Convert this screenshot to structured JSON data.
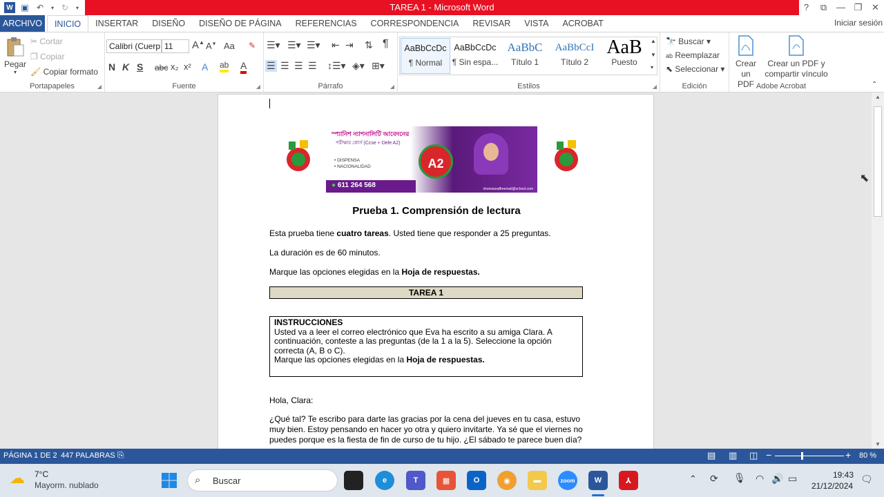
{
  "window": {
    "title": "TAREA 1 -  Microsoft Word",
    "help": "?",
    "restore_ribbon": "⧉",
    "minimize": "—",
    "maximize": "❐",
    "close": "✕"
  },
  "qat": {
    "word_icon": "W",
    "save": "💾",
    "undo": "↶",
    "redo": "↻",
    "customize": "▾"
  },
  "menu": {
    "file": "ARCHIVO",
    "tabs": [
      "INICIO",
      "INSERTAR",
      "DISEÑO",
      "DISEÑO DE PÁGINA",
      "REFERENCIAS",
      "CORRESPONDENCIA",
      "REVISAR",
      "VISTA",
      "ACROBAT"
    ],
    "signin": "Iniciar sesión"
  },
  "clipboard": {
    "paste": "Pegar",
    "cut": "Cortar",
    "copy": "Copiar",
    "format_painter": "Copiar formato",
    "label": "Portapapeles"
  },
  "font": {
    "name": "Calibri (Cuerp",
    "size": "11",
    "grow": "A",
    "shrink": "A",
    "case": "Aa",
    "clear": "✎",
    "bold": "N",
    "italic": "K",
    "underline": "S",
    "strike": "abc",
    "sub": "x₂",
    "sup": "x²",
    "effects": "A",
    "highlight": "ab",
    "color": "A",
    "label": "Fuente"
  },
  "paragraph": {
    "label": "Párrafo",
    "pilcrow": "¶"
  },
  "styles": {
    "label": "Estilos",
    "items": [
      {
        "preview": "AaBbCcDc",
        "name": "¶ Normal"
      },
      {
        "preview": "AaBbCcDc",
        "name": "¶ Sin espa..."
      },
      {
        "preview": "AaBbC",
        "name": "Título 1"
      },
      {
        "preview": "AaBbCcI",
        "name": "Título 2"
      },
      {
        "preview": "AaB",
        "name": "Puesto"
      }
    ]
  },
  "editing": {
    "find": "Buscar",
    "replace": "Reemplazar",
    "select": "Seleccionar",
    "label": "Edición"
  },
  "acrobat": {
    "create_pdf": "Crear un PDF",
    "create_share": "Crear un PDF y compartir vínculo",
    "label": "Adobe Acrobat"
  },
  "document": {
    "banner": {
      "title_bn": "স্প্যানিশ ন্যাশনালিটি আবেদনের",
      "subtitle": "পরীক্ষার কোর্স (Ccse + Dele A2)",
      "bullets": [
        "• DISPENSA",
        "• NACIONALIDAD"
      ],
      "phone": "611 264 568",
      "badge": "A2",
      "email": "shomaveaffreemail@school.com"
    },
    "heading": "Prueba 1. Comprensión de lectura",
    "p1_pre": "Esta prueba tiene ",
    "p1_bold": "cuatro tareas",
    "p1_post": ". Usted tiene que responder a 25 preguntas.",
    "p2": "La duración es de 60 minutos.",
    "p3_pre": "Marque las opciones elegidas en la ",
    "p3_bold": "Hoja de respuestas.",
    "task": "TAREA 1",
    "instr_title": "INSTRUCCIONES",
    "instr_body": "Usted va a leer el correo electrónico que Eva ha escrito a su amiga Clara. A continuación, conteste a las preguntas (de la 1 a la 5). Seleccione la opción correcta (A, B o C).",
    "instr_mark_pre": "Marque las opciones elegidas en la ",
    "instr_mark_bold": "Hoja de respuestas.",
    "greeting": "Hola, Clara:",
    "body": "¿Qué tal? Te escribo para darte las gracias por la cena del jueves en tu casa, estuvo muy bien. Estoy pensando en hacer yo otra y quiero invitarte. Ya sé que el viernes no puedes porque es la fiesta de fin de curso de tu hijo. ¿El sábado te parece buen día?"
  },
  "status": {
    "page": "PÁGINA 1 DE 2",
    "words": "447 PALABRAS",
    "zoom": "80 %",
    "zoom_level": 0.8
  },
  "taskbar": {
    "temp": "7°C",
    "weather": "Mayorm. nublado",
    "search": "Buscar",
    "time": "19:43",
    "date": "21/12/2024",
    "zoom_app": "zoom"
  }
}
